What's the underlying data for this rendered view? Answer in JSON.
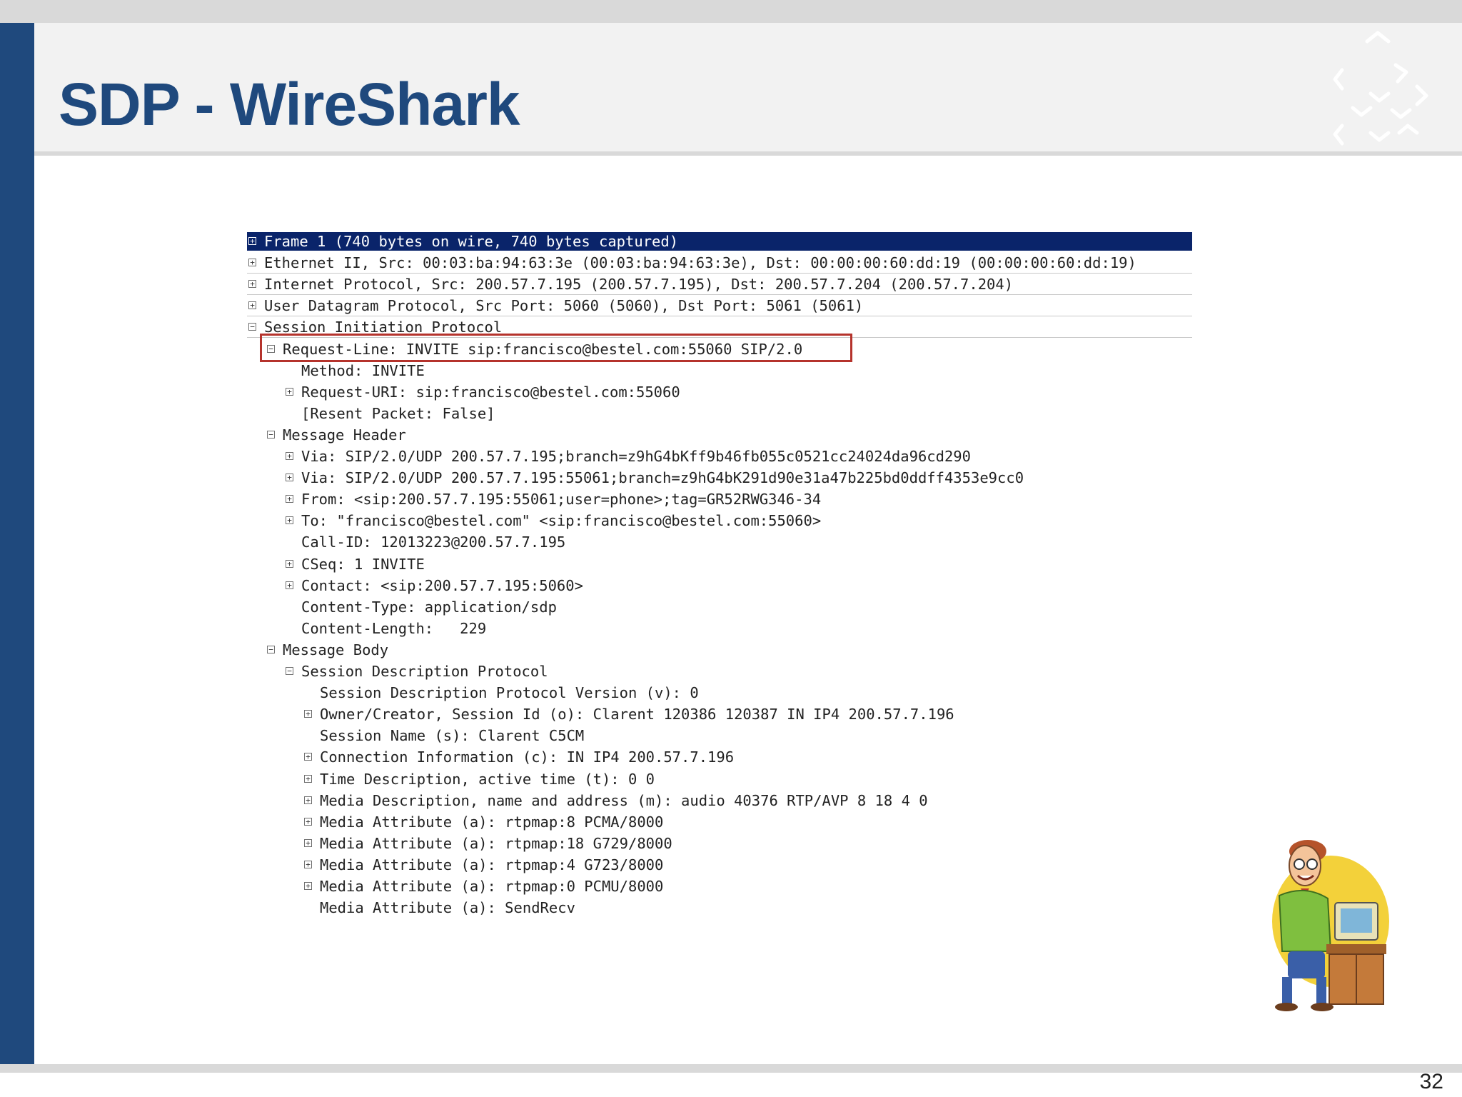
{
  "slide": {
    "title": "SDP - WireShark",
    "page_number": "32"
  },
  "colors": {
    "accent": "#1f497d",
    "selection": "#0a246a",
    "highlight": "#b5332c"
  },
  "capture": {
    "rows": [
      {
        "indent": 0,
        "toggle": "+",
        "text": "Frame 1 (740 bytes on wire, 740 bytes captured)",
        "selected": true
      },
      {
        "indent": 0,
        "toggle": "+",
        "text": "Ethernet II, Src: 00:03:ba:94:63:3e (00:03:ba:94:63:3e), Dst: 00:00:00:60:dd:19 (00:00:00:60:dd:19)"
      },
      {
        "indent": 0,
        "toggle": "+",
        "text": "Internet Protocol, Src: 200.57.7.195 (200.57.7.195), Dst: 200.57.7.204 (200.57.7.204)"
      },
      {
        "indent": 0,
        "toggle": "+",
        "text": "User Datagram Protocol, Src Port: 5060 (5060), Dst Port: 5061 (5061)"
      },
      {
        "indent": 0,
        "toggle": "-",
        "text": "Session Initiation Protocol"
      },
      {
        "indent": 1,
        "toggle": "-",
        "text": "Request-Line: INVITE sip:francisco@bestel.com:55060 SIP/2.0"
      },
      {
        "indent": 2,
        "toggle": "",
        "text": "Method: INVITE"
      },
      {
        "indent": 2,
        "toggle": "+",
        "text": "Request-URI: sip:francisco@bestel.com:55060"
      },
      {
        "indent": 2,
        "toggle": "",
        "text": "[Resent Packet: False]"
      },
      {
        "indent": 1,
        "toggle": "-",
        "text": "Message Header"
      },
      {
        "indent": 2,
        "toggle": "+",
        "text": "Via: SIP/2.0/UDP 200.57.7.195;branch=z9hG4bKff9b46fb055c0521cc24024da96cd290"
      },
      {
        "indent": 2,
        "toggle": "+",
        "text": "Via: SIP/2.0/UDP 200.57.7.195:55061;branch=z9hG4bK291d90e31a47b225bd0ddff4353e9cc0"
      },
      {
        "indent": 2,
        "toggle": "+",
        "text": "From: <sip:200.57.7.195:55061;user=phone>;tag=GR52RWG346-34"
      },
      {
        "indent": 2,
        "toggle": "+",
        "text": "To: \"francisco@bestel.com\" <sip:francisco@bestel.com:55060>"
      },
      {
        "indent": 2,
        "toggle": "",
        "text": "Call-ID: 12013223@200.57.7.195"
      },
      {
        "indent": 2,
        "toggle": "+",
        "text": "CSeq: 1 INVITE"
      },
      {
        "indent": 2,
        "toggle": "+",
        "text": "Contact: <sip:200.57.7.195:5060>"
      },
      {
        "indent": 2,
        "toggle": "",
        "text": "Content-Type: application/sdp"
      },
      {
        "indent": 2,
        "toggle": "",
        "text": "Content-Length:   229"
      },
      {
        "indent": 1,
        "toggle": "-",
        "text": "Message Body"
      },
      {
        "indent": 2,
        "toggle": "-",
        "text": "Session Description Protocol"
      },
      {
        "indent": 3,
        "toggle": "",
        "text": "Session Description Protocol Version (v): 0"
      },
      {
        "indent": 3,
        "toggle": "+",
        "text": "Owner/Creator, Session Id (o): Clarent 120386 120387 IN IP4 200.57.7.196"
      },
      {
        "indent": 3,
        "toggle": "",
        "text": "Session Name (s): Clarent C5CM"
      },
      {
        "indent": 3,
        "toggle": "+",
        "text": "Connection Information (c): IN IP4 200.57.7.196"
      },
      {
        "indent": 3,
        "toggle": "+",
        "text": "Time Description, active time (t): 0 0"
      },
      {
        "indent": 3,
        "toggle": "+",
        "text": "Media Description, name and address (m): audio 40376 RTP/AVP 8 18 4 0"
      },
      {
        "indent": 3,
        "toggle": "+",
        "text": "Media Attribute (a): rtpmap:8 PCMA/8000"
      },
      {
        "indent": 3,
        "toggle": "+",
        "text": "Media Attribute (a): rtpmap:18 G729/8000"
      },
      {
        "indent": 3,
        "toggle": "+",
        "text": "Media Attribute (a): rtpmap:4 G723/8000"
      },
      {
        "indent": 3,
        "toggle": "+",
        "text": "Media Attribute (a): rtpmap:0 PCMU/8000"
      },
      {
        "indent": 3,
        "toggle": "",
        "text": "Media Attribute (a): SendRecv"
      }
    ]
  },
  "icons": {
    "corner_decoration": "chevron-pattern-icon",
    "mascot": "cartoon-man-at-computer"
  }
}
